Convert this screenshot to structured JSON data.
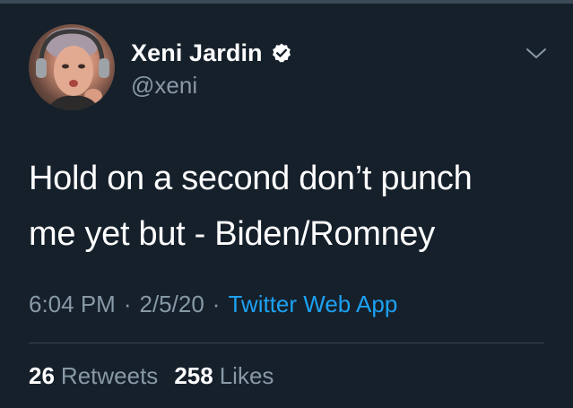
{
  "tweet": {
    "author": {
      "display_name": "Xeni Jardin",
      "handle": "@xeni",
      "verified": true,
      "avatar_icon": "profile-photo"
    },
    "text_lines": [
      "Hold on a second don’t punch",
      "me yet but - Biden/Romney"
    ],
    "meta": {
      "time": "6:04 PM",
      "separator": "·",
      "date": "2/5/20",
      "source": "Twitter Web App"
    },
    "stats": {
      "retweets_count": "26",
      "retweets_label": "Retweets",
      "likes_count": "258",
      "likes_label": "Likes"
    },
    "menu_icon": "chevron-down-icon"
  },
  "theme": {
    "background": "#15202b",
    "text_primary": "#ffffff",
    "text_secondary": "#8899a6",
    "link": "#1da1f2",
    "divider": "#38444d"
  }
}
